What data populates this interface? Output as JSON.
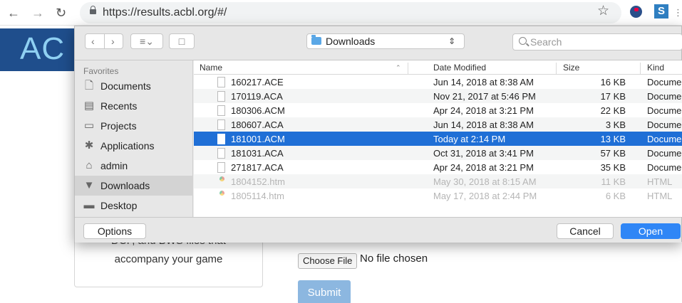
{
  "browser": {
    "url": "https://results.acbl.org/#/",
    "back_icon": "arrow-left-icon",
    "forward_icon": "arrow-right-icon",
    "reload_icon": "reload-icon",
    "bookmark_icon": "star-icon"
  },
  "page": {
    "logo_text": "AC",
    "card_line1": "DCF, and BWS files that",
    "card_line2": "accompany your game",
    "choose_file_label": "Choose File",
    "no_file_text": "No file chosen",
    "submit_label": "Submit",
    "brand_color": "#1f4e8c"
  },
  "dialog": {
    "location": "Downloads",
    "search_placeholder": "Search",
    "favorites_label": "Favorites",
    "sidebar": [
      {
        "label": "Documents",
        "icon": "document-icon"
      },
      {
        "label": "Recents",
        "icon": "recents-icon"
      },
      {
        "label": "Projects",
        "icon": "folder-icon"
      },
      {
        "label": "Applications",
        "icon": "applications-icon"
      },
      {
        "label": "admin",
        "icon": "home-icon"
      },
      {
        "label": "Downloads",
        "icon": "downloads-icon",
        "selected": true
      },
      {
        "label": "Desktop",
        "icon": "desktop-icon"
      }
    ],
    "columns": {
      "name": "Name",
      "date": "Date Modified",
      "size": "Size",
      "kind": "Kind"
    },
    "files": [
      {
        "name": "160217.ACE",
        "date": "Jun 14, 2018 at 8:38 AM",
        "size": "16 KB",
        "kind": "Documer",
        "icon": "document-icon"
      },
      {
        "name": "170119.ACA",
        "date": "Nov 21, 2017 at 5:46 PM",
        "size": "17 KB",
        "kind": "Documer",
        "icon": "document-icon"
      },
      {
        "name": "180306.ACM",
        "date": "Apr 24, 2018 at 3:21 PM",
        "size": "22 KB",
        "kind": "Documer",
        "icon": "document-icon"
      },
      {
        "name": "180607.ACA",
        "date": "Jun 14, 2018 at 8:38 AM",
        "size": "3 KB",
        "kind": "Documer",
        "icon": "document-icon"
      },
      {
        "name": "181001.ACM",
        "date": "Today at 2:14 PM",
        "size": "13 KB",
        "kind": "Documer",
        "icon": "document-icon",
        "selected": true
      },
      {
        "name": "181031.ACA",
        "date": "Oct 31, 2018 at 3:41 PM",
        "size": "57 KB",
        "kind": "Documer",
        "icon": "document-icon"
      },
      {
        "name": "271817.ACA",
        "date": "Apr 24, 2018 at 3:21 PM",
        "size": "35 KB",
        "kind": "Documer",
        "icon": "document-icon"
      },
      {
        "name": "1804152.htm",
        "date": "May 30, 2018 at 8:15 AM",
        "size": "11 KB",
        "kind": "HTML",
        "icon": "chrome-icon",
        "disabled": true
      },
      {
        "name": "1805114.htm",
        "date": "May 17, 2018 at 2:44 PM",
        "size": "6 KB",
        "kind": "HTML",
        "icon": "chrome-icon",
        "disabled": true
      }
    ],
    "options_label": "Options",
    "cancel_label": "Cancel",
    "open_label": "Open",
    "selection_color": "#1f6fd6",
    "accent_color": "#2f86f6"
  }
}
